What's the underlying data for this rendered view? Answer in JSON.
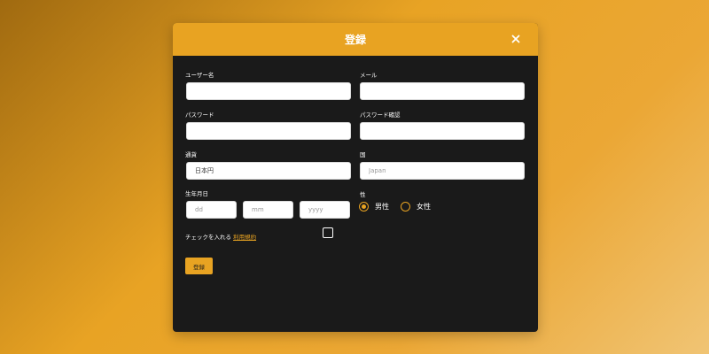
{
  "modal": {
    "title": "登録"
  },
  "form": {
    "username": {
      "label": "ユーザー名",
      "value": "",
      "placeholder": ""
    },
    "email": {
      "label": "メール",
      "value": "",
      "placeholder": ""
    },
    "password": {
      "label": "パスワード",
      "value": "",
      "placeholder": ""
    },
    "password_confirm": {
      "label": "パスワード確認",
      "value": "",
      "placeholder": ""
    },
    "currency": {
      "label": "通貨",
      "value": "日本円",
      "placeholder": ""
    },
    "country": {
      "label": "国",
      "value": "",
      "placeholder": "Japan"
    },
    "birthdate": {
      "label": "生年月日",
      "day_placeholder": "dd",
      "month_placeholder": "mm",
      "year_placeholder": "yyyy"
    },
    "gender": {
      "label": "性",
      "options": [
        "男性",
        "女性"
      ],
      "selected": "男性"
    },
    "terms": {
      "prefix": "チェックを入れる",
      "link_text": "利用規約",
      "checked": false
    },
    "submit_label": "登録"
  },
  "colors": {
    "accent": "#e8a322",
    "panel": "#1a1a1a",
    "text": "#ffffff"
  },
  "icons": {
    "close": "close-icon"
  }
}
